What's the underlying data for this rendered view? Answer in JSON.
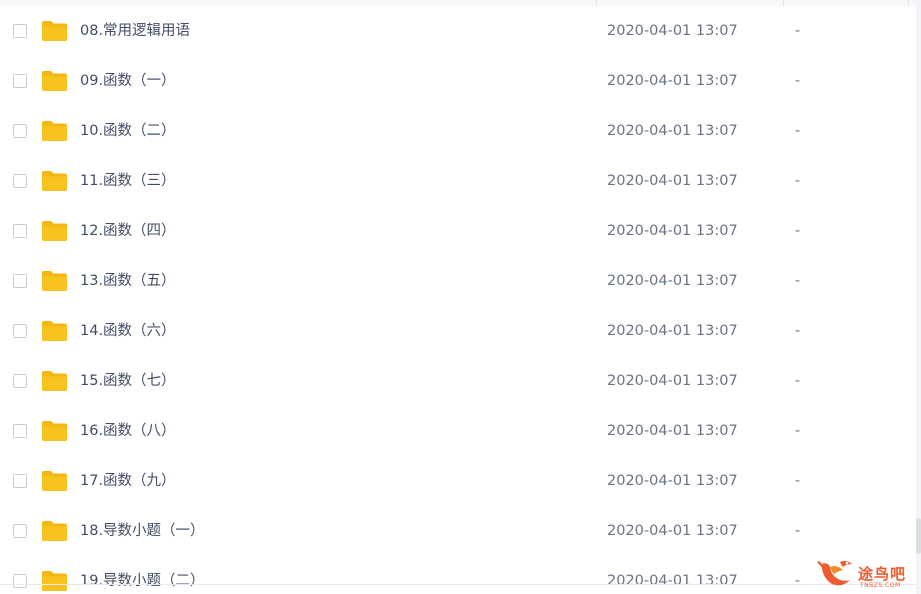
{
  "file_list": {
    "rows": [
      {
        "name": "08.常用逻辑用语",
        "date": "2020-04-01 13:07",
        "size": "-"
      },
      {
        "name": "09.函数（一）",
        "date": "2020-04-01 13:07",
        "size": "-"
      },
      {
        "name": "10.函数（二）",
        "date": "2020-04-01 13:07",
        "size": "-"
      },
      {
        "name": "11.函数（三）",
        "date": "2020-04-01 13:07",
        "size": "-"
      },
      {
        "name": "12.函数（四）",
        "date": "2020-04-01 13:07",
        "size": "-"
      },
      {
        "name": "13.函数（五）",
        "date": "2020-04-01 13:07",
        "size": "-"
      },
      {
        "name": "14.函数（六）",
        "date": "2020-04-01 13:07",
        "size": "-"
      },
      {
        "name": "15.函数（七）",
        "date": "2020-04-01 13:07",
        "size": "-"
      },
      {
        "name": "16.函数（八）",
        "date": "2020-04-01 13:07",
        "size": "-"
      },
      {
        "name": "17.函数（九）",
        "date": "2020-04-01 13:07",
        "size": "-"
      },
      {
        "name": "18.导数小题（一）",
        "date": "2020-04-01 13:07",
        "size": "-"
      },
      {
        "name": "19.导数小题（二）",
        "date": "2020-04-01 13:07",
        "size": "-"
      }
    ],
    "row_icon": "folder-icon"
  },
  "watermark": {
    "text": "途鸟吧",
    "domain": "TNBZS.COM"
  },
  "colors": {
    "folder": "#f9c31f",
    "folder_tab": "#f4b613",
    "name_text": "#424e67",
    "meta_text": "#6b7383",
    "checkbox_border": "#c9ccd3",
    "watermark": "#ef5b30"
  }
}
